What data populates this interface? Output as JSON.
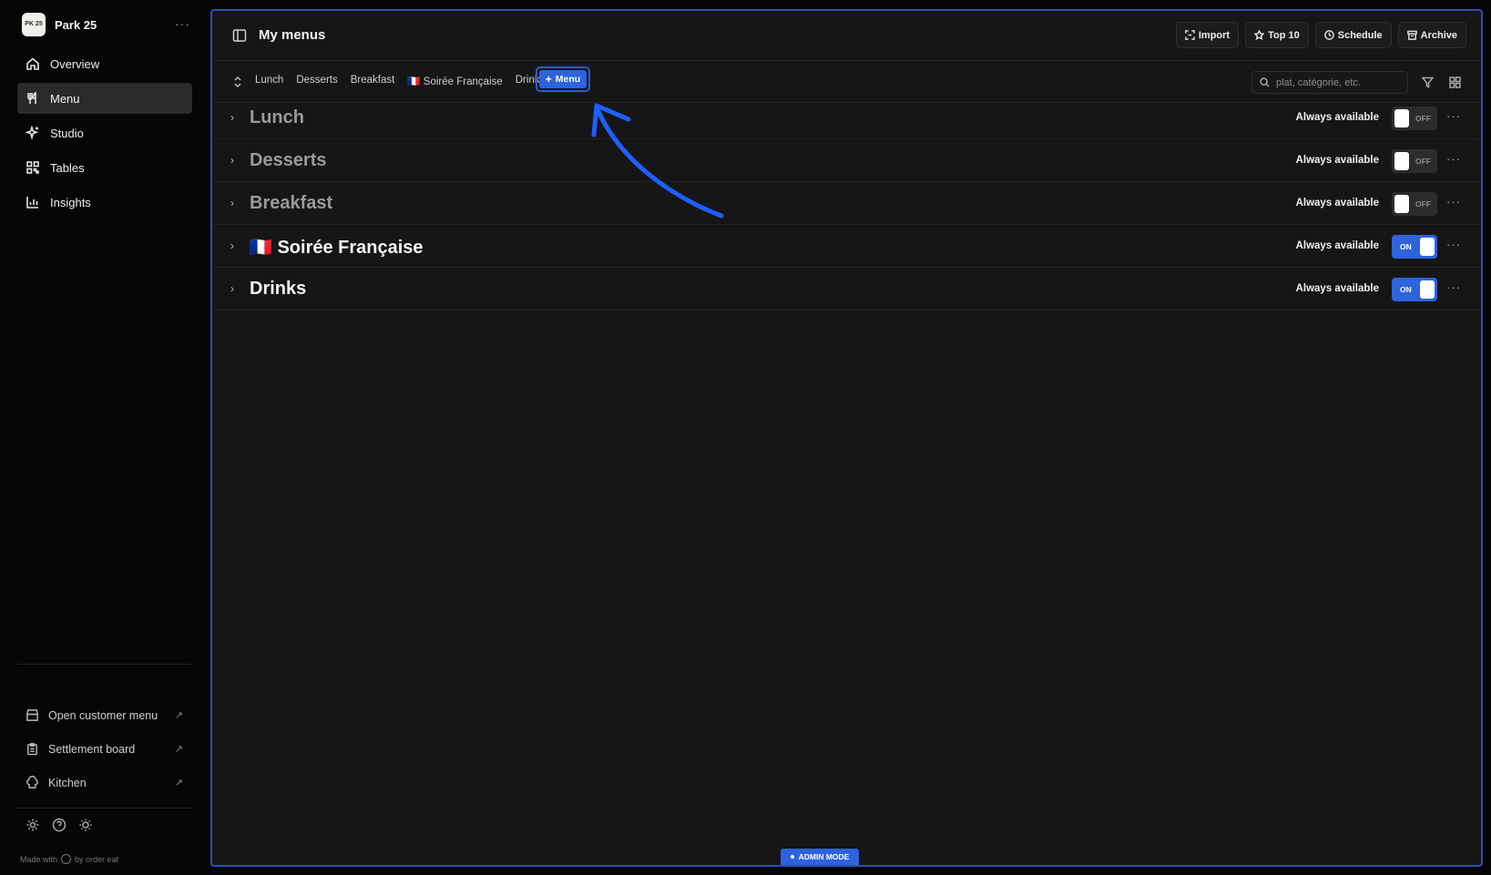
{
  "brand": {
    "name": "Park 25",
    "logo_text": "PK 25",
    "more": "···"
  },
  "nav": [
    {
      "label": "Overview",
      "icon": "home-icon",
      "active": false
    },
    {
      "label": "Menu",
      "icon": "utensils-icon",
      "active": true
    },
    {
      "label": "Studio",
      "icon": "sparkles-icon",
      "active": false
    },
    {
      "label": "Tables",
      "icon": "qr-code-icon",
      "active": false
    },
    {
      "label": "Insights",
      "icon": "bar-chart-icon",
      "active": false
    }
  ],
  "external_links": [
    {
      "label": "Open customer menu",
      "icon": "store-icon",
      "arrow": "↗"
    },
    {
      "label": "Settlement board",
      "icon": "clipboard-icon",
      "arrow": "↗"
    },
    {
      "label": "Kitchen",
      "icon": "chef-hat-icon",
      "arrow": "↗"
    }
  ],
  "footer": {
    "made_with": "Made with",
    "by": "by order eat"
  },
  "header": {
    "title": "My menus",
    "actions": [
      {
        "label": "Import",
        "icon": "import-icon"
      },
      {
        "label": "Top 10",
        "icon": "star-icon"
      },
      {
        "label": "Schedule",
        "icon": "clock-icon"
      },
      {
        "label": "Archive",
        "icon": "archive-icon"
      }
    ]
  },
  "tabs": [
    "Lunch",
    "Desserts",
    "Breakfast",
    "🇫🇷 Soirée Française",
    "Drinks"
  ],
  "add_menu": {
    "plus": "+",
    "label": "Menu"
  },
  "search": {
    "placeholder": "plat, catégorie, etc.",
    "value": ""
  },
  "menus": [
    {
      "name": "Lunch",
      "availability": "Always available",
      "state": "OFF",
      "enabled": false
    },
    {
      "name": "Desserts",
      "availability": "Always available",
      "state": "OFF",
      "enabled": false
    },
    {
      "name": "Breakfast",
      "availability": "Always available",
      "state": "OFF",
      "enabled": false
    },
    {
      "name": "🇫🇷 Soirée Française",
      "availability": "Always available",
      "state": "ON",
      "enabled": true
    },
    {
      "name": "Drinks",
      "availability": "Always available",
      "state": "ON",
      "enabled": true
    }
  ],
  "admin_badge": "ADMIN MODE",
  "colors": {
    "accent": "#2d63dd",
    "panel": "#161617",
    "sidebar": "#060606",
    "annotation_arrow": "#1f5fff"
  }
}
